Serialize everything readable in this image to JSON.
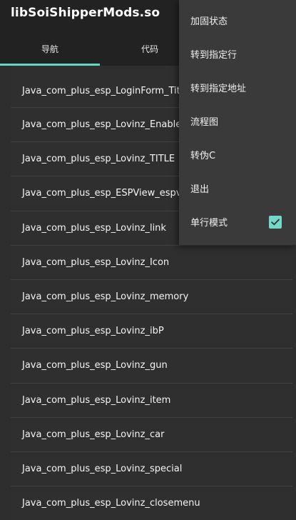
{
  "app": {
    "title": "libSoiShipperMods.so"
  },
  "tabs": [
    {
      "label": "导航",
      "active": true
    },
    {
      "label": "代码",
      "active": false
    }
  ],
  "list": {
    "items": [
      "Java_com_plus_esp_LoginForm_Title",
      "Java_com_plus_esp_Lovinz_EnableSou",
      "Java_com_plus_esp_Lovinz_TITLE",
      "Java_com_plus_esp_ESPView_espview",
      "Java_com_plus_esp_Lovinz_link",
      "Java_com_plus_esp_Lovinz_Icon",
      "Java_com_plus_esp_Lovinz_memory",
      "Java_com_plus_esp_Lovinz_ibP",
      "Java_com_plus_esp_Lovinz_gun",
      "Java_com_plus_esp_Lovinz_item",
      "Java_com_plus_esp_Lovinz_car",
      "Java_com_plus_esp_Lovinz_special",
      "Java_com_plus_esp_Lovinz_closemenu"
    ]
  },
  "menu": {
    "items": [
      {
        "label": "加固状态"
      },
      {
        "label": "转到指定行"
      },
      {
        "label": "转到指定地址"
      },
      {
        "label": "流程图"
      },
      {
        "label": "转伪C"
      },
      {
        "label": "退出"
      },
      {
        "label": "单行模式",
        "checked": true
      }
    ]
  },
  "colors": {
    "accent": "#68d7c0",
    "background": "#2f2f2f",
    "topbar": "#222222",
    "menu": "#3a3a3a"
  }
}
